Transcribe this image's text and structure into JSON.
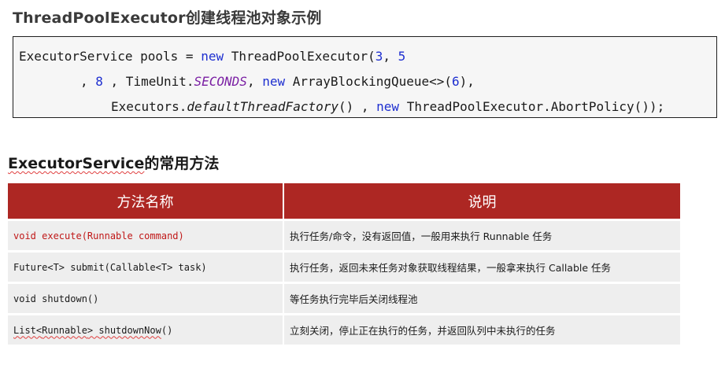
{
  "heading_1": "ThreadPoolExecutor创建线程池对象示例",
  "code": {
    "line1": {
      "a": "ExecutorService pools = ",
      "kw_new": "new",
      "b": " ThreadPoolExecutor(",
      "n1": "3",
      "c": ", ",
      "n2": "5"
    },
    "line2": {
      "a": ", ",
      "n1": "8",
      "b": " , TimeUnit.",
      "const": "SECONDS",
      "c": ", ",
      "kw_new": "new",
      "d": " ArrayBlockingQueue<>(",
      "n2": "6",
      "e": "),"
    },
    "line3": {
      "a": "Executors.",
      "method": "defaultThreadFactory",
      "b": "() , ",
      "kw_new": "new",
      "c": " ThreadPoolExecutor.AbortPolicy());"
    }
  },
  "heading_2": {
    "word": "ExecutorService",
    "rest": "的常用方法"
  },
  "table": {
    "headers": [
      "方法名称",
      "说明"
    ],
    "rows": [
      {
        "method": "void execute(Runnable command)",
        "desc": "执行任务/命令，没有返回值，一般用来执行 Runnable 任务"
      },
      {
        "method": "Future<T> submit(Callable<T> task)",
        "desc": "执行任务，返回未来任务对象获取线程结果，一般拿来执行 Callable 任务"
      },
      {
        "method": "void shutdown()",
        "desc": "等任务执行完毕后关闭线程池"
      },
      {
        "method_parts": [
          "List<",
          "Runnable",
          "> ",
          "shutdownNow",
          "()"
        ],
        "desc": "立刻关闭，停止正在执行的任务，并返回队列中未执行的任务"
      }
    ]
  },
  "colors": {
    "header_bg": "#ad2723",
    "cell_bg": "#eeeeee",
    "keyword": "#1e2fd0",
    "constant": "#7a1fa3",
    "highlight_text": "#c01818"
  }
}
